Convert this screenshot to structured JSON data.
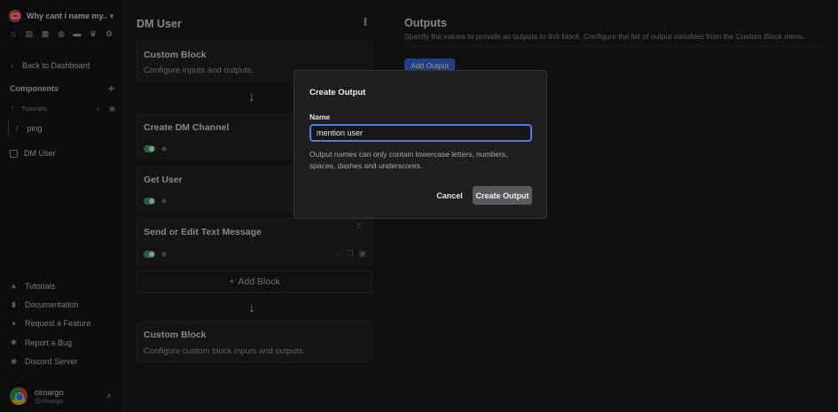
{
  "sidebar": {
    "server_name": "Why cant i name my...",
    "nav_icons": [
      "home-icon",
      "book-icon",
      "grid-icon",
      "globe-icon",
      "table-icon",
      "crown-icon",
      "gear-icon"
    ],
    "back_label": "Back to Dashboard",
    "components_label": "Components",
    "folder_label": "Tutorials",
    "folder_items": [
      {
        "label": "ping",
        "icon": "slash-icon"
      }
    ],
    "top_level_items": [
      {
        "label": "DM User",
        "icon": "box-icon"
      }
    ],
    "footer_links": [
      {
        "label": "Tutorials",
        "icon": "graduation-cap-icon"
      },
      {
        "label": "Documentation",
        "icon": "book-icon"
      },
      {
        "label": "Request a Feature",
        "icon": "sparkle-icon"
      },
      {
        "label": "Report a Bug",
        "icon": "bug-icon"
      },
      {
        "label": "Discord Server",
        "icon": "discord-icon"
      }
    ],
    "user": {
      "name": "olmargo",
      "handle": "@olmargo"
    }
  },
  "editor": {
    "title": "DM User",
    "blocks": [
      {
        "title": "Custom Block",
        "desc": "Configure inputs and outputs."
      },
      {
        "title": "Create DM Channel"
      },
      {
        "title": "Get User"
      },
      {
        "title": "Send or Edit Text Message"
      }
    ],
    "add_block_label": "Add Block",
    "end_block": {
      "title": "Custom Block",
      "desc": "Configure custom block inputs and outputs."
    }
  },
  "outputs": {
    "title": "Outputs",
    "subtitle": "Specify the values to provide as outputs to this block. Configure the list of output variables from the Custom Block menu.",
    "add_button": "Add Output"
  },
  "modal": {
    "title": "Create Output",
    "field_label": "Name",
    "field_value": "mention user",
    "help_text": "Output names can only contain lowercase letters, numbers, spaces, dashes and underscores.",
    "cancel_label": "Cancel",
    "create_label": "Create Output"
  },
  "colors": {
    "accent": "#3b6de0",
    "input_focus": "#4b7bf5",
    "toggle_on": "#3aa76d",
    "server_logo": "#e0524f"
  }
}
